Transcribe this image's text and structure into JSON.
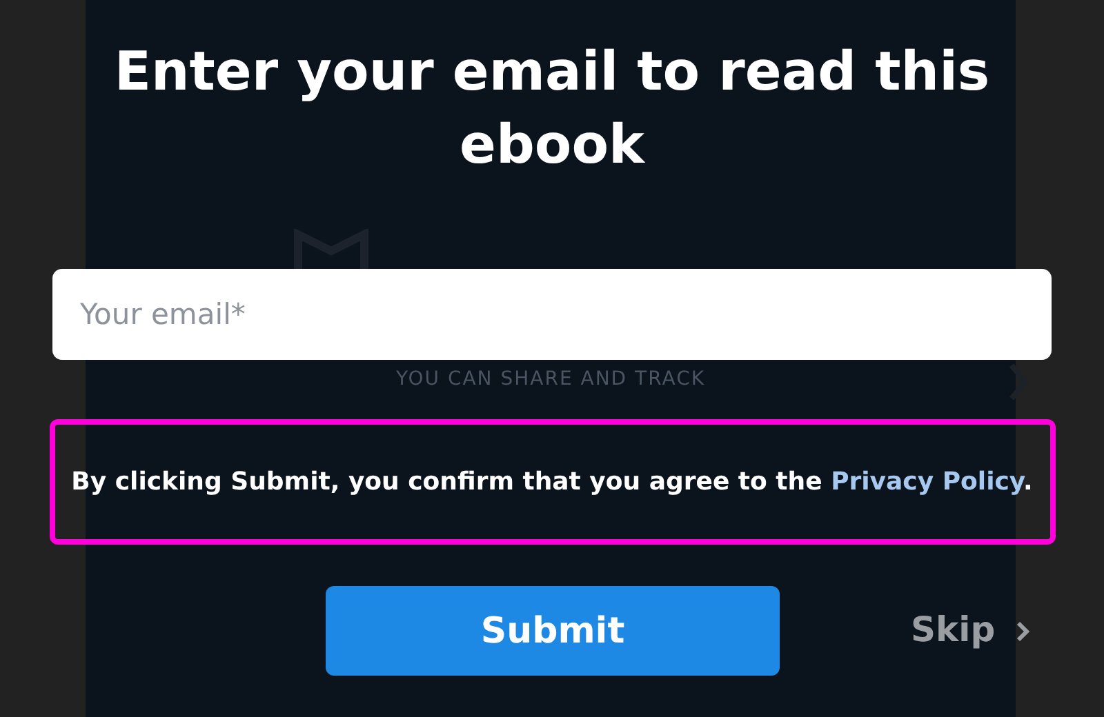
{
  "background": {
    "tagline": "YOU CAN SHARE AND TRACK"
  },
  "title": "Enter your email to read this ebook",
  "email": {
    "placeholder": "Your email*"
  },
  "consent": {
    "text": "By clicking Submit, you confirm that you agree to the ",
    "link": "Privacy Policy",
    "end": "."
  },
  "submit": "Submit",
  "skip": "Skip"
}
